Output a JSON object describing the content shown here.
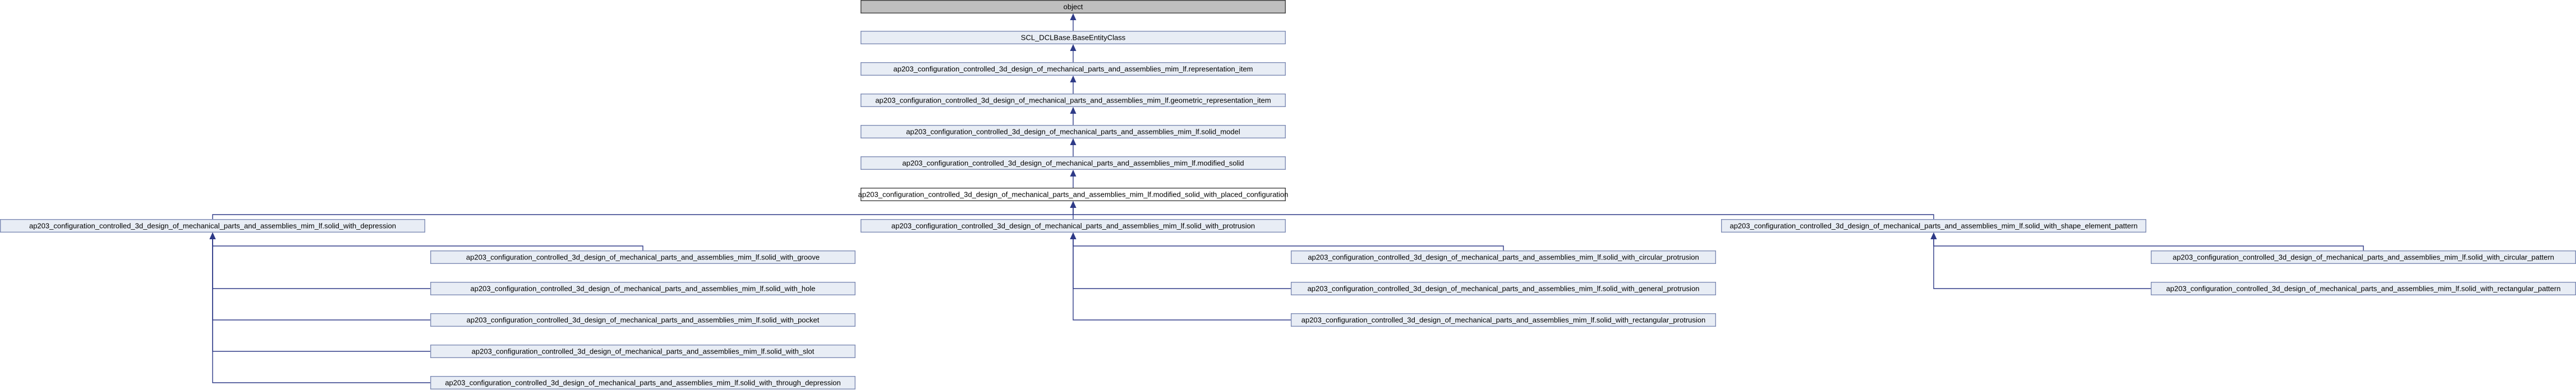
{
  "nodes": {
    "object": {
      "label": "object",
      "kind": "root"
    },
    "base_entity": {
      "label": "SCL_DCLBase.BaseEntityClass",
      "kind": "normal"
    },
    "representation_item": {
      "label": "ap203_configuration_controlled_3d_design_of_mechanical_parts_and_assemblies_mim_lf.representation_item",
      "kind": "normal"
    },
    "geometric_representation_item": {
      "label": "ap203_configuration_controlled_3d_design_of_mechanical_parts_and_assemblies_mim_lf.geometric_representation_item",
      "kind": "normal"
    },
    "solid_model": {
      "label": "ap203_configuration_controlled_3d_design_of_mechanical_parts_and_assemblies_mim_lf.solid_model",
      "kind": "normal"
    },
    "modified_solid": {
      "label": "ap203_configuration_controlled_3d_design_of_mechanical_parts_and_assemblies_mim_lf.modified_solid",
      "kind": "normal"
    },
    "modified_solid_with_placed_configuration": {
      "label": "ap203_configuration_controlled_3d_design_of_mechanical_parts_and_assemblies_mim_lf.modified_solid_with_placed_configuration",
      "kind": "highlight"
    },
    "solid_with_depression": {
      "label": "ap203_configuration_controlled_3d_design_of_mechanical_parts_and_assemblies_mim_lf.solid_with_depression",
      "kind": "normal"
    },
    "solid_with_protrusion": {
      "label": "ap203_configuration_controlled_3d_design_of_mechanical_parts_and_assemblies_mim_lf.solid_with_protrusion",
      "kind": "normal"
    },
    "solid_with_shape_element_pattern": {
      "label": "ap203_configuration_controlled_3d_design_of_mechanical_parts_and_assemblies_mim_lf.solid_with_shape_element_pattern",
      "kind": "normal"
    },
    "solid_with_groove": {
      "label": "ap203_configuration_controlled_3d_design_of_mechanical_parts_and_assemblies_mim_lf.solid_with_groove",
      "kind": "normal"
    },
    "solid_with_hole": {
      "label": "ap203_configuration_controlled_3d_design_of_mechanical_parts_and_assemblies_mim_lf.solid_with_hole",
      "kind": "normal"
    },
    "solid_with_pocket": {
      "label": "ap203_configuration_controlled_3d_design_of_mechanical_parts_and_assemblies_mim_lf.solid_with_pocket",
      "kind": "normal"
    },
    "solid_with_slot": {
      "label": "ap203_configuration_controlled_3d_design_of_mechanical_parts_and_assemblies_mim_lf.solid_with_slot",
      "kind": "normal"
    },
    "solid_with_through_depression": {
      "label": "ap203_configuration_controlled_3d_design_of_mechanical_parts_and_assemblies_mim_lf.solid_with_through_depression",
      "kind": "normal"
    },
    "solid_with_circular_protrusion": {
      "label": "ap203_configuration_controlled_3d_design_of_mechanical_parts_and_assemblies_mim_lf.solid_with_circular_protrusion",
      "kind": "normal"
    },
    "solid_with_general_protrusion": {
      "label": "ap203_configuration_controlled_3d_design_of_mechanical_parts_and_assemblies_mim_lf.solid_with_general_protrusion",
      "kind": "normal"
    },
    "solid_with_rectangular_protrusion": {
      "label": "ap203_configuration_controlled_3d_design_of_mechanical_parts_and_assemblies_mim_lf.solid_with_rectangular_protrusion",
      "kind": "normal"
    },
    "solid_with_circular_pattern": {
      "label": "ap203_configuration_controlled_3d_design_of_mechanical_parts_and_assemblies_mim_lf.solid_with_circular_pattern",
      "kind": "normal"
    },
    "solid_with_rectangular_pattern": {
      "label": "ap203_configuration_controlled_3d_design_of_mechanical_parts_and_assemblies_mim_lf.solid_with_rectangular_pattern",
      "kind": "normal"
    }
  },
  "edges": [
    {
      "child": "base_entity",
      "parent": "object"
    },
    {
      "child": "representation_item",
      "parent": "base_entity"
    },
    {
      "child": "geometric_representation_item",
      "parent": "representation_item"
    },
    {
      "child": "solid_model",
      "parent": "geometric_representation_item"
    },
    {
      "child": "modified_solid",
      "parent": "solid_model"
    },
    {
      "child": "modified_solid_with_placed_configuration",
      "parent": "modified_solid"
    },
    {
      "child": "solid_with_depression",
      "parent": "modified_solid_with_placed_configuration"
    },
    {
      "child": "solid_with_protrusion",
      "parent": "modified_solid_with_placed_configuration"
    },
    {
      "child": "solid_with_shape_element_pattern",
      "parent": "modified_solid_with_placed_configuration"
    },
    {
      "child": "solid_with_groove",
      "parent": "solid_with_depression"
    },
    {
      "child": "solid_with_hole",
      "parent": "solid_with_depression"
    },
    {
      "child": "solid_with_pocket",
      "parent": "solid_with_depression"
    },
    {
      "child": "solid_with_slot",
      "parent": "solid_with_depression"
    },
    {
      "child": "solid_with_through_depression",
      "parent": "solid_with_depression"
    },
    {
      "child": "solid_with_circular_protrusion",
      "parent": "solid_with_protrusion"
    },
    {
      "child": "solid_with_general_protrusion",
      "parent": "solid_with_protrusion"
    },
    {
      "child": "solid_with_rectangular_protrusion",
      "parent": "solid_with_protrusion"
    },
    {
      "child": "solid_with_circular_pattern",
      "parent": "solid_with_shape_element_pattern"
    },
    {
      "child": "solid_with_rectangular_pattern",
      "parent": "solid_with_shape_element_pattern"
    }
  ]
}
